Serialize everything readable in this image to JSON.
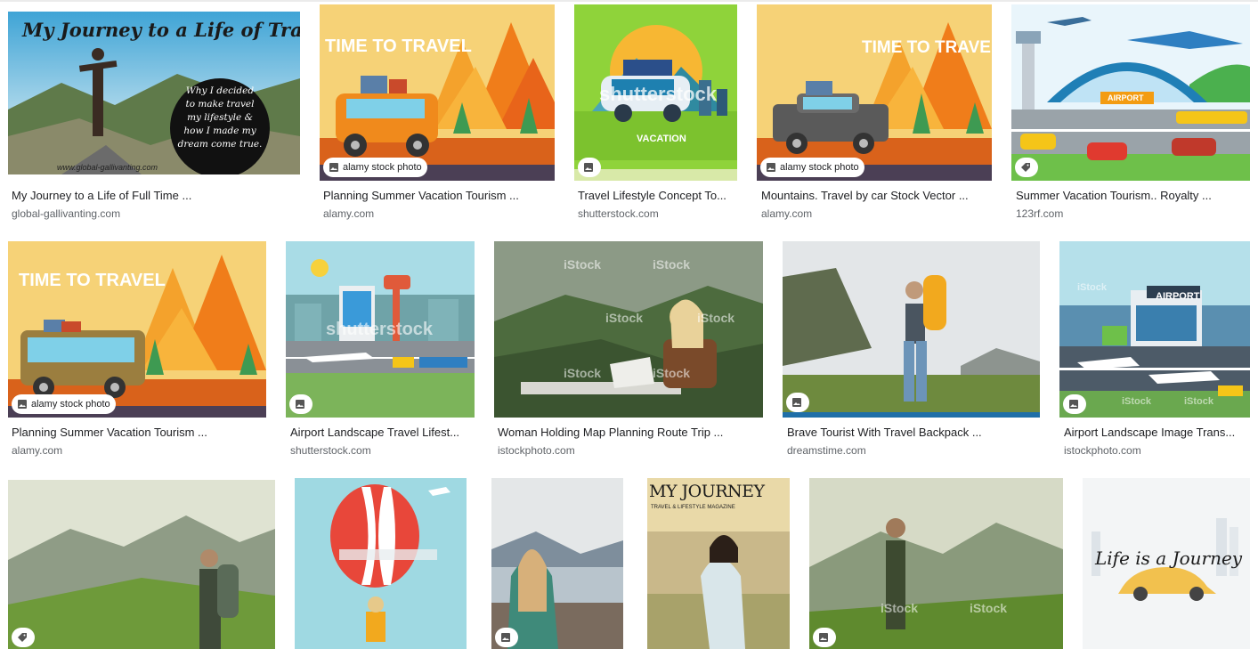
{
  "results": [
    {
      "title": "My Journey to a Life of Full Time ...",
      "source": "global-gallivanting.com",
      "overlay": {
        "heading": "My Journey to a Life of Travel",
        "circle_lines": [
          "Why I decided",
          "to make travel",
          "my lifestyle &",
          "how I made my",
          "dream come true."
        ],
        "footer": "www.global-gallivanting.com"
      }
    },
    {
      "title": "Planning Summer Vacation Tourism ...",
      "source": "alamy.com",
      "overlay": {
        "heading": "TIME TO TRAVEL",
        "badge": "alamy stock photo"
      }
    },
    {
      "title": "Travel Lifestyle Concept To...",
      "source": "shutterstock.com",
      "overlay": {
        "watermark": "shutterstock",
        "label": "VACATION"
      }
    },
    {
      "title": "Mountains. Travel by car Stock Vector ...",
      "source": "alamy.com",
      "overlay": {
        "heading": "TIME TO TRAVEL",
        "badge": "alamy stock photo"
      }
    },
    {
      "title": "Summer Vacation Tourism.. Royalty ...",
      "source": "123rf.com",
      "overlay": {
        "sign": "AIRPORT"
      }
    },
    {
      "title": "Planning Summer Vacation Tourism ...",
      "source": "alamy.com",
      "overlay": {
        "heading": "TIME TO TRAVEL",
        "badge": "alamy stock photo"
      }
    },
    {
      "title": "Airport Landscape Travel Lifest...",
      "source": "shutterstock.com",
      "overlay": {
        "watermark": "shutterstock"
      }
    },
    {
      "title": "Woman Holding Map Planning Route Trip ...",
      "source": "istockphoto.com",
      "overlay": {
        "watermark": "iStock"
      }
    },
    {
      "title": "Brave Tourist With Travel Backpack ...",
      "source": "dreamstime.com",
      "overlay": {}
    },
    {
      "title": "Airport Landscape Image Trans...",
      "source": "istockphoto.com",
      "overlay": {
        "sign": "AIRPORT",
        "watermark": "iStock"
      }
    },
    {
      "overlay": {}
    },
    {
      "overlay": {}
    },
    {
      "overlay": {}
    },
    {
      "overlay": {
        "heading": "MY JOURNEY",
        "subheading": "TRAVEL & LIFESTYLE MAGAZINE"
      }
    },
    {
      "overlay": {
        "watermark": "iStock"
      }
    },
    {
      "overlay": {
        "heading": "Life is a Journey"
      }
    }
  ],
  "icons": {
    "image_badge": "image-icon",
    "tag_badge": "tag-icon"
  },
  "colors": {
    "title_text": "#202124",
    "source_text": "#5f6368",
    "badge_bg": "#ffffff"
  }
}
